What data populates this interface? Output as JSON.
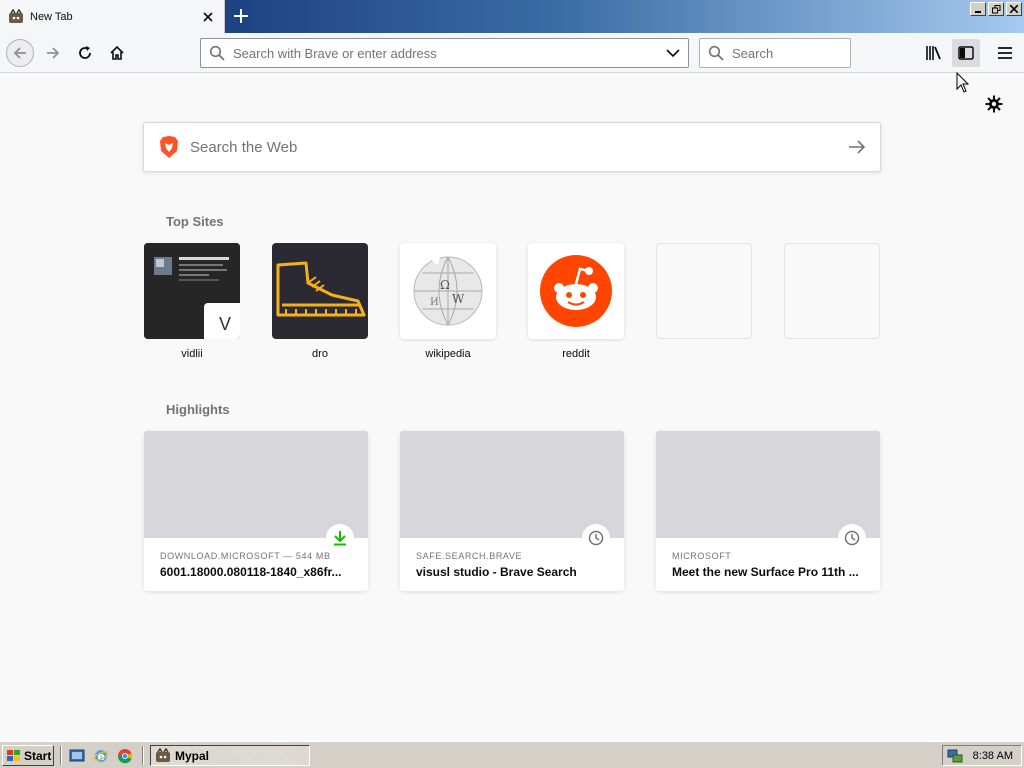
{
  "tab": {
    "title": "New Tab"
  },
  "navbar": {
    "url_placeholder": "Search with Brave or enter address",
    "search_placeholder": "Search"
  },
  "content": {
    "websearch_placeholder": "Search the Web",
    "top_sites_title": "Top Sites",
    "top_sites": [
      {
        "label": "vidlii",
        "badge": "V"
      },
      {
        "label": "dro"
      },
      {
        "label": "wikipedia"
      },
      {
        "label": "reddit"
      },
      {
        "label": ""
      },
      {
        "label": ""
      }
    ],
    "highlights_title": "Highlights",
    "highlights": [
      {
        "host": "DOWNLOAD.MICROSOFT — 544 MB",
        "title": "6001.18000.080118-1840_x86fr...",
        "badge_icon": "download-icon"
      },
      {
        "host": "SAFE.SEARCH.BRAVE",
        "title": "visusl studio - Brave Search",
        "badge_icon": "clock-icon"
      },
      {
        "host": "MICROSOFT",
        "title": "Meet the new Surface Pro 11th ...",
        "badge_icon": "clock-icon"
      }
    ]
  },
  "taskbar": {
    "start_label": "Start",
    "task_label": "Mypal",
    "clock": "8:38 AM"
  },
  "colors": {
    "reddit": "#ff4500",
    "dro_tile": "#2b2a33",
    "dro_boot": "#f6b01a",
    "brave": "#fb542b",
    "download_green": "#12bc00"
  }
}
